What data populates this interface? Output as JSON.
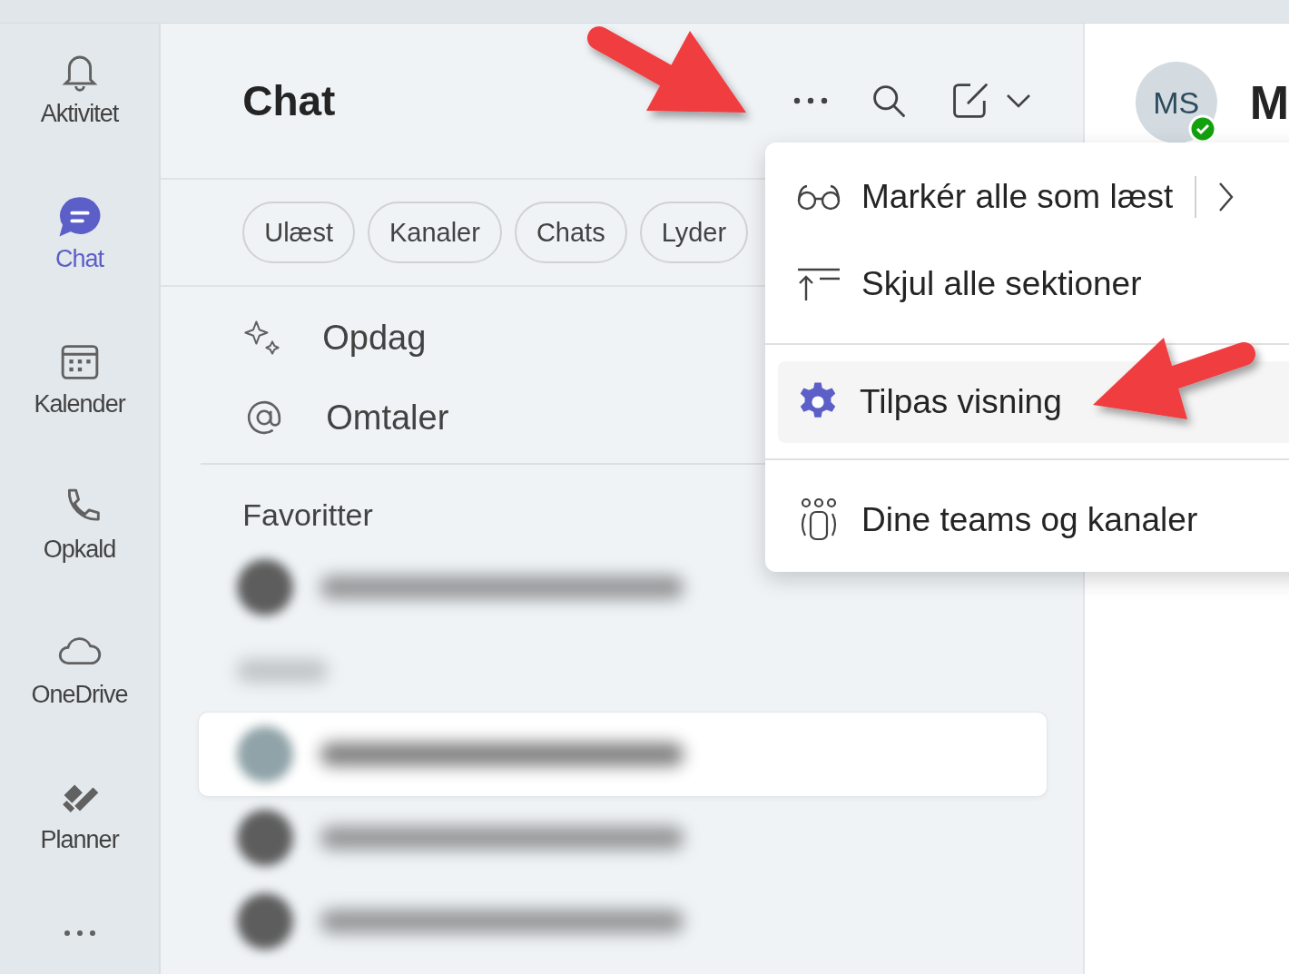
{
  "rail": {
    "items": [
      {
        "label": "Aktivitet",
        "selected": false
      },
      {
        "label": "Chat",
        "selected": true
      },
      {
        "label": "Kalender",
        "selected": false
      },
      {
        "label": "Opkald",
        "selected": false
      },
      {
        "label": "OneDrive",
        "selected": false
      },
      {
        "label": "Planner",
        "selected": false
      }
    ]
  },
  "chat_panel": {
    "title": "Chat",
    "filters": [
      {
        "label": "Ulæst"
      },
      {
        "label": "Kanaler"
      },
      {
        "label": "Chats"
      },
      {
        "label": "Lyder"
      }
    ],
    "nav": [
      {
        "label": "Opdag"
      },
      {
        "label": "Omtaler"
      }
    ],
    "section": "Favoritter",
    "blurred_rows": [
      {
        "kind": "contact",
        "selected": false
      },
      {
        "kind": "section",
        "selected": false
      },
      {
        "kind": "contact",
        "selected": true
      },
      {
        "kind": "contact",
        "selected": false
      },
      {
        "kind": "contact",
        "selected": false
      }
    ]
  },
  "menu": {
    "items": [
      {
        "kind": "item",
        "label": "Markér alle som læst",
        "submenu": true,
        "selected": false
      },
      {
        "kind": "item",
        "label": "Skjul alle sektioner",
        "submenu": false,
        "selected": false
      },
      {
        "kind": "divider"
      },
      {
        "kind": "item",
        "label": "Tilpas visning",
        "submenu": false,
        "selected": true
      },
      {
        "kind": "divider"
      },
      {
        "kind": "item",
        "label": "Dine teams og kanaler",
        "submenu": false,
        "selected": false
      }
    ]
  },
  "conversation": {
    "avatar": "MS",
    "online": true,
    "title": "M"
  }
}
